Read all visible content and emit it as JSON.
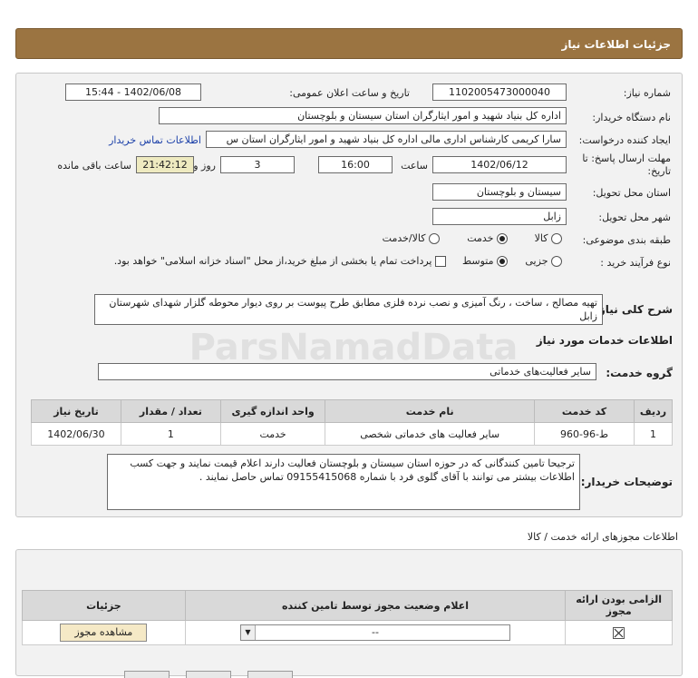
{
  "page": {
    "header_title": "جزئیات اطلاعات نیاز"
  },
  "form": {
    "need_number_label": "شماره نیاز:",
    "need_number": "1102005473000040",
    "announce_label": "تاریخ و ساعت اعلان عمومی:",
    "announce_value": "1402/06/08 - 15:44",
    "buyer_label": "نام دستگاه خریدار:",
    "buyer_value": "اداره کل بنیاد شهید و امور ایثارگران استان سیستان و بلوچستان",
    "requester_label": "ایجاد کننده درخواست:",
    "requester_value": "سارا کریمی کارشناس اداری مالی اداره کل بنیاد شهید و امور ایثارگران استان س",
    "contact_link": "اطلاعات تماس خریدار",
    "deadline_label_1": "مهلت ارسال پاسخ: تا",
    "deadline_label_2": "تاریخ:",
    "deadline_date": "1402/06/12",
    "time_label": "ساعت",
    "deadline_time": "16:00",
    "days_value": "3",
    "days_label": "روز و",
    "remaining_time": "21:42:12",
    "remaining_label": "ساعت باقی مانده",
    "province_label": "استان محل تحویل:",
    "province_value": "سیستان و بلوچستان",
    "city_label": "شهر محل تحویل:",
    "city_value": "زابل",
    "category_label": "طبقه بندی موضوعی:",
    "category_options": [
      "کالا",
      "خدمت",
      "کالا/خدمت"
    ],
    "purchase_type_label": "نوع فرآیند خرید :",
    "purchase_options": [
      "جزیی",
      "متوسط"
    ],
    "treasury_note": "پرداخت تمام یا بخشی از مبلغ خرید،از محل \"اسناد خزانه اسلامی\" خواهد بود."
  },
  "description": {
    "label": "شرح کلی نیاز:",
    "text": "تهیه مصالح ، ساخت ، رنگ آمیزی و نصب نرده فلزی مطابق طرح پیوست بر روی دیوار محوطه گلزار شهدای شهرستان زابل"
  },
  "services": {
    "section_title": "اطلاعات خدمات مورد نیاز",
    "group_label": "گروه خدمت:",
    "group_value": "سایر فعالیت‌های خدماتی",
    "columns": [
      "ردیف",
      "کد خدمت",
      "نام خدمت",
      "واحد اندازه گیری",
      "تعداد / مقدار",
      "تاریخ نیاز"
    ],
    "rows": [
      [
        "1",
        "ط-96-960",
        "سایر فعالیت های خدماتی شخصی",
        "خدمت",
        "1",
        "1402/06/30"
      ]
    ]
  },
  "buyer_notes": {
    "label": "توضیحات خریدار:",
    "text": "ترجیحا تامین کنندگانی که در حوزه استان سیستان و بلوچستان فعالیت دارند اعلام قیمت نمایند و جهت کسب اطلاعات بیشتر می توانند با آقای گلوی فرد با شماره 09155415068 تماس حاصل نمایند ."
  },
  "permits": {
    "section_title": "اطلاعات مجوزهای ارائه خدمت / کالا",
    "columns": [
      "الزامی بودن ارائه مجوز",
      "اعلام وضعیت مجوز توسط تامین کننده",
      "جزئیات"
    ],
    "select_value": "--",
    "view_button": "مشاهده مجوز"
  },
  "watermark": {
    "text": "ParsNamadData"
  }
}
